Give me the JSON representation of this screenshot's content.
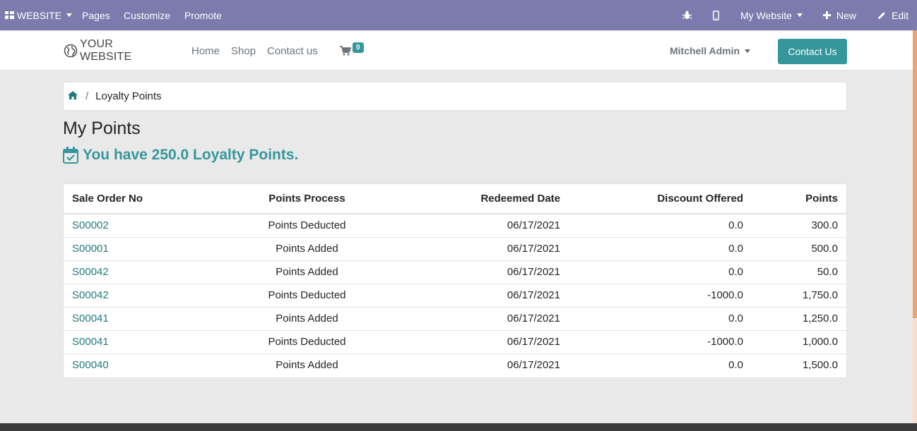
{
  "admin_bar": {
    "website_menu": "WEBSITE",
    "pages": "Pages",
    "customize": "Customize",
    "promote": "Promote",
    "my_website": "My Website",
    "new": "New",
    "edit": "Edit",
    "color": "#7c7bad"
  },
  "header": {
    "logo_text": "YOUR WEBSITE",
    "nav": {
      "home": "Home",
      "shop": "Shop",
      "contact": "Contact us"
    },
    "cart_count": "0",
    "user": "Mitchell Admin",
    "contact_button": "Contact Us",
    "accent": "#35979c"
  },
  "breadcrumb": {
    "current": "Loyalty Points"
  },
  "page": {
    "title": "My Points",
    "points_message": "You have 250.0 Loyalty Points."
  },
  "table": {
    "headers": [
      "Sale Order No",
      "Points Process",
      "Redeemed Date",
      "Discount Offered",
      "Points"
    ],
    "rows": [
      [
        "S00002",
        "Points Deducted",
        "06/17/2021",
        "0.0",
        "300.0"
      ],
      [
        "S00001",
        "Points Added",
        "06/17/2021",
        "0.0",
        "500.0"
      ],
      [
        "S00042",
        "Points Added",
        "06/17/2021",
        "0.0",
        "50.0"
      ],
      [
        "S00042",
        "Points Deducted",
        "06/17/2021",
        "-1000.0",
        "1,750.0"
      ],
      [
        "S00041",
        "Points Added",
        "06/17/2021",
        "0.0",
        "1,250.0"
      ],
      [
        "S00041",
        "Points Deducted",
        "06/17/2021",
        "-1000.0",
        "1,000.0"
      ],
      [
        "S00040",
        "Points Added",
        "06/17/2021",
        "0.0",
        "1,500.0"
      ]
    ]
  }
}
